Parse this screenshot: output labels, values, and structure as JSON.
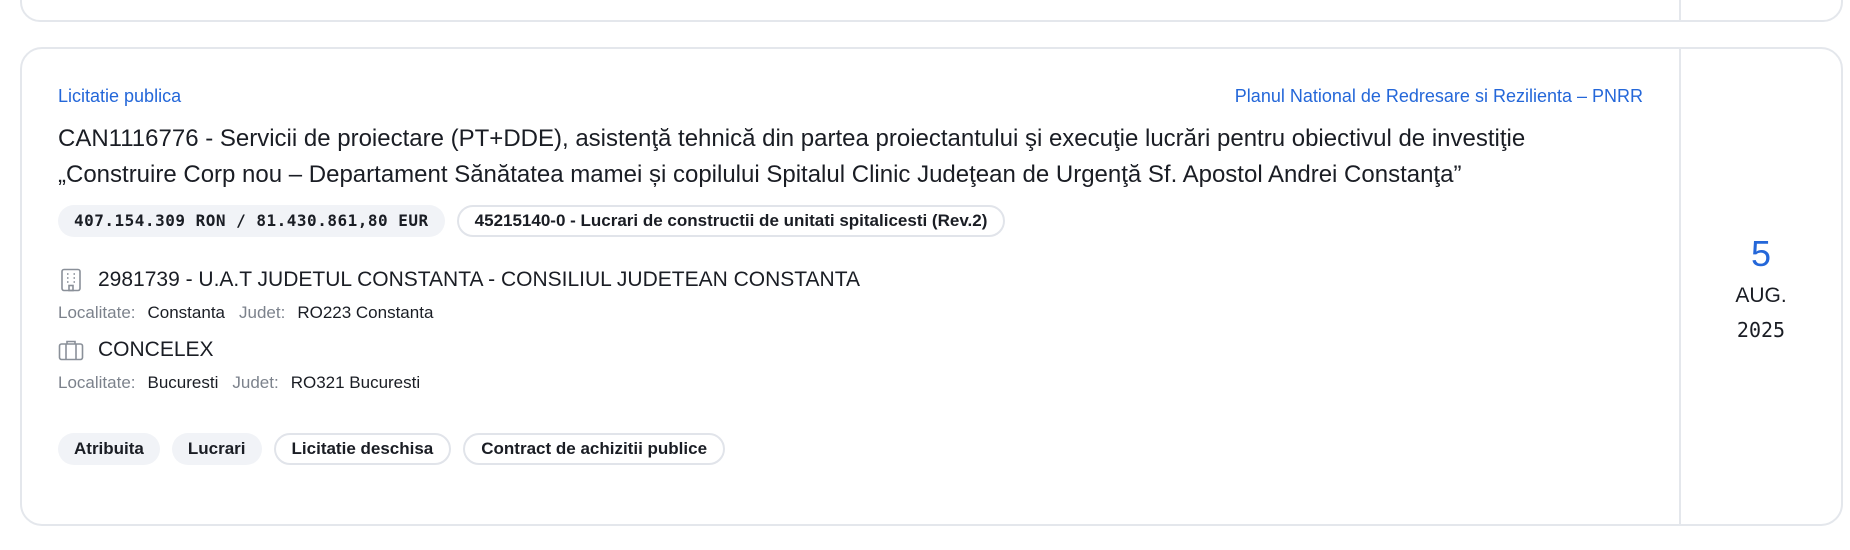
{
  "procedure_type": "Licitatie publica",
  "funding_program": "Planul National de Redresare si Rezilienta – PNRR",
  "title": "CAN1116776 - Servicii de proiectare (PT+DDE), asistenţă tehnică din partea proiectantului şi execuţie lucrări pentru obiectivul de investiţie „Construire Corp nou – Departament Sănătatea mamei și copilului Spitalul Clinic Judeţean de Urgenţă Sf. Apostol Andrei Constanţa”",
  "value_chip": "407.154.309 RON / 81.430.861,80 EUR",
  "cpv_chip": "45215140-0 - Lucrari de constructii de unitati spitalicesti (Rev.2)",
  "authority": {
    "name": "2981739 - U.A.T JUDETUL CONSTANTA - CONSILIUL JUDETEAN CONSTANTA",
    "locality_label": "Localitate:",
    "locality": "Constanta",
    "county_label": "Judet:",
    "county": "RO223 Constanta",
    "icon": "building-icon"
  },
  "supplier": {
    "name": "CONCELEX",
    "locality_label": "Localitate:",
    "locality": "Bucuresti",
    "county_label": "Judet:",
    "county": "RO321 Bucuresti",
    "icon": "briefcase-icon"
  },
  "tags": [
    {
      "label": "Atribuita"
    },
    {
      "label": "Lucrari"
    },
    {
      "label": "Licitatie deschisa"
    },
    {
      "label": "Contract de achizitii publice"
    }
  ],
  "date": {
    "day": "5",
    "month": "AUG.",
    "year": "2025"
  },
  "colors": {
    "accent": "#2467d9",
    "border": "#e4e7ec",
    "chip_bg": "#f1f3f7"
  }
}
